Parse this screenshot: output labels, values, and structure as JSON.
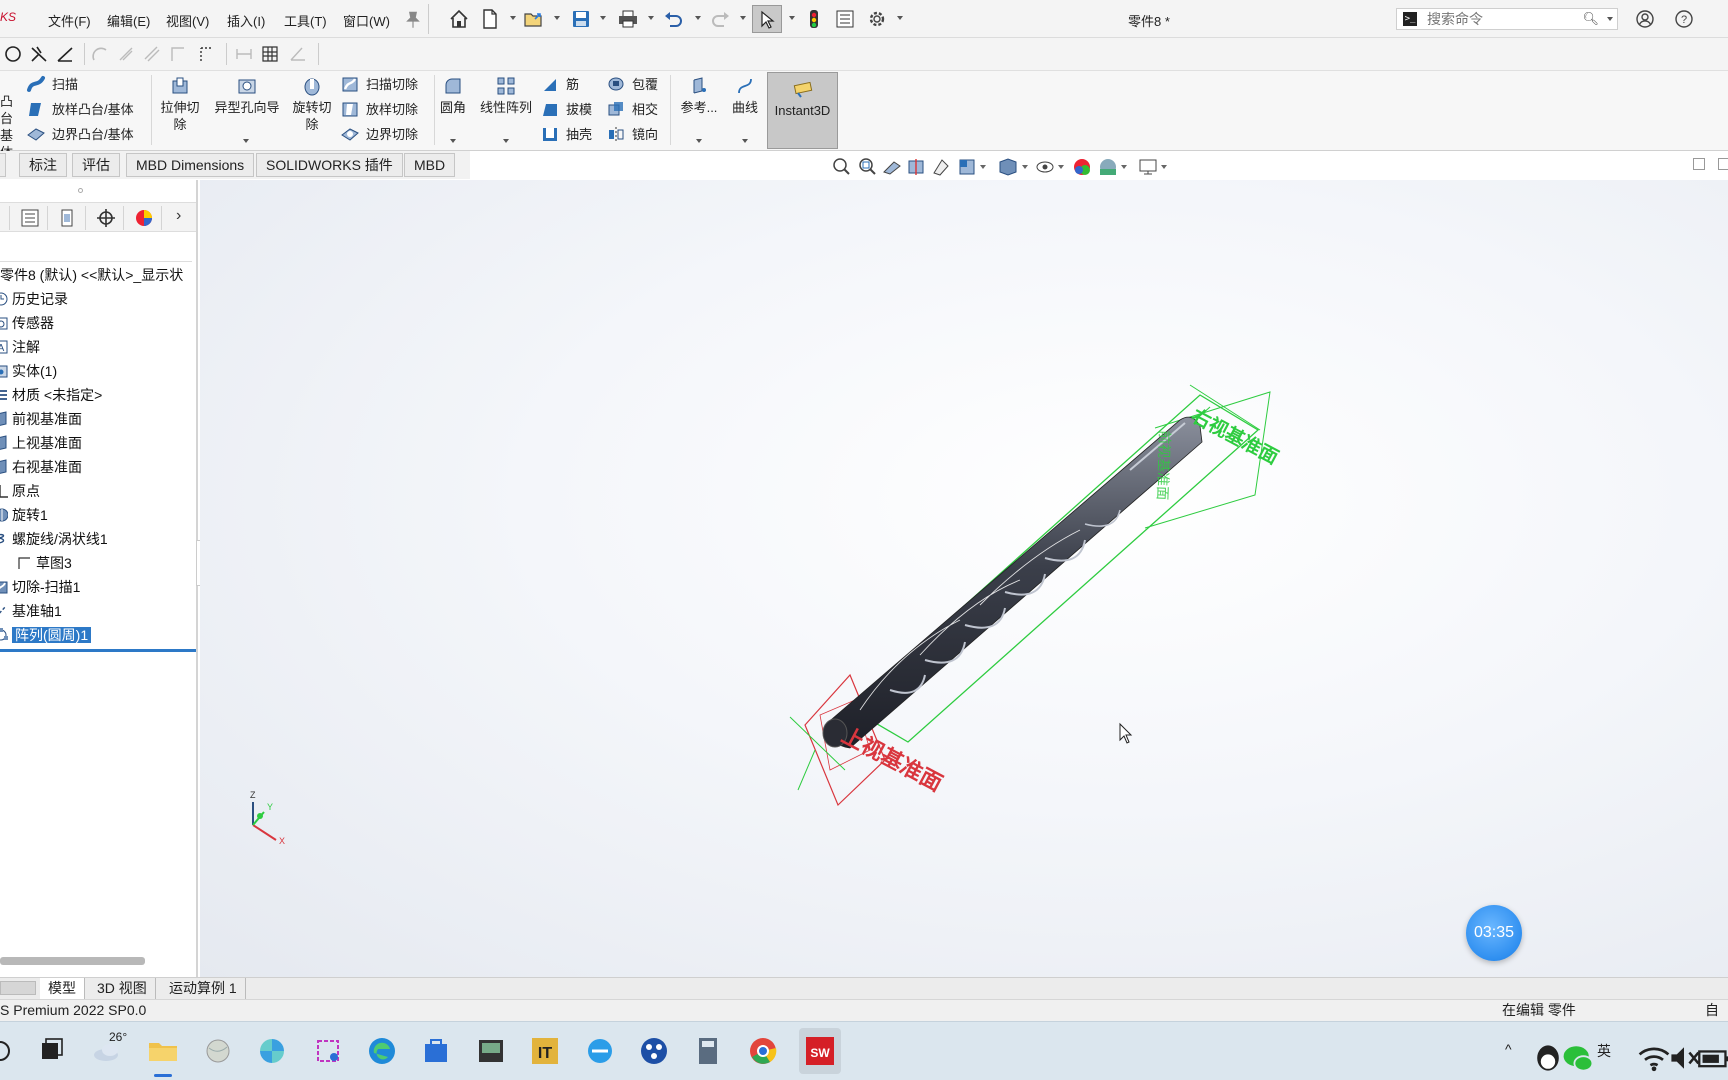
{
  "app": {
    "brand": "KS",
    "document_title": "零件8 *",
    "menus": [
      "文件(F)",
      "编辑(E)",
      "视图(V)",
      "插入(I)",
      "工具(T)",
      "窗口(W)"
    ]
  },
  "search": {
    "placeholder": "搜索命令"
  },
  "commands": {
    "small_left": [
      "扫描",
      "放样凸台/基体",
      "边界凸台/基体"
    ],
    "partial_left": [
      "凸台",
      "基体"
    ],
    "large": {
      "extrude_cut": "拉伸切除",
      "hole_wizard": "异型孔向导",
      "revolve_cut": "旋转切除",
      "fillet": "圆角",
      "linear_pattern": "线性阵列",
      "reference": "参考...",
      "curves": "曲线",
      "instant3d": "Instant3D"
    },
    "small_cut": [
      "扫描切除",
      "放样切除",
      "边界切除"
    ],
    "small_features_a": [
      "筋",
      "拔模",
      "抽壳"
    ],
    "small_features_b": [
      "包覆",
      "相交",
      "镜向"
    ]
  },
  "tabs": [
    "标注",
    "评估",
    "MBD Dimensions",
    "SOLIDWORKS 插件",
    "MBD"
  ],
  "feature_tree": {
    "root": "零件8 (默认) <<默认>_显示状",
    "items": [
      {
        "label": "历史记录",
        "icon": "history-icon"
      },
      {
        "label": "传感器",
        "icon": "sensor-icon"
      },
      {
        "label": "注解",
        "icon": "annotation-icon"
      },
      {
        "label": "实体(1)",
        "icon": "solid-body-icon"
      },
      {
        "label": "材质 <未指定>",
        "icon": "material-icon"
      },
      {
        "label": "前视基准面",
        "icon": "plane-icon"
      },
      {
        "label": "上视基准面",
        "icon": "plane-icon"
      },
      {
        "label": "右视基准面",
        "icon": "plane-icon"
      },
      {
        "label": "原点",
        "icon": "origin-icon"
      },
      {
        "label": "旋转1",
        "icon": "revolve-icon"
      },
      {
        "label": "螺旋线/涡状线1",
        "icon": "helix-icon"
      },
      {
        "label": "草图3",
        "icon": "sketch-icon"
      },
      {
        "label": "切除-扫描1",
        "icon": "sweep-cut-icon"
      },
      {
        "label": "基准轴1",
        "icon": "axis-icon"
      },
      {
        "label": "阵列(圆周)1",
        "icon": "circular-pattern-icon"
      }
    ]
  },
  "viewport": {
    "plane_label_top": "上视基准面",
    "plane_label_right": "右视基准面",
    "plane_label_vertical": "前视基准面",
    "triad": {
      "x": "X",
      "y": "Y",
      "z": "Z"
    },
    "timer": "03:35"
  },
  "bottom_tabs": [
    "模型",
    "3D 视图",
    "运动算例 1"
  ],
  "status": {
    "left": "S Premium 2022 SP0.0",
    "right": "在编辑 零件",
    "far_right": "自定"
  },
  "taskbar": {
    "weather": "26°",
    "ime": "英"
  },
  "colors": {
    "selection": "#2d79c7",
    "plane_green": "#2ecc40",
    "plane_red": "#d9363e",
    "brand_red": "#c8102e"
  }
}
